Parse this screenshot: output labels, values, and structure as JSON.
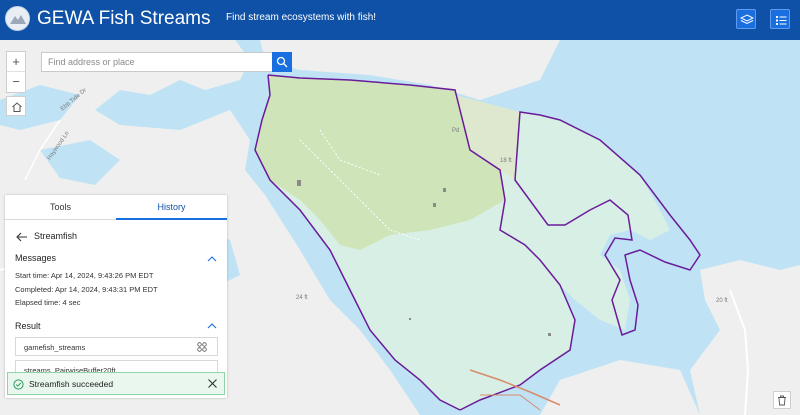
{
  "header": {
    "title": "GEWA Fish Streams",
    "subtitle": "Find stream ecosystems with fish!",
    "layers_icon": "layers-icon",
    "legend_icon": "list-icon",
    "bg_color": "#0e51a7"
  },
  "search": {
    "placeholder": "Find address or place",
    "button_icon": "search-icon"
  },
  "controls": {
    "zoom_in": "+",
    "zoom_out": "−",
    "home_icon": "home-icon",
    "trash_icon": "trash-icon"
  },
  "map": {
    "water_color": "#bfe3f5",
    "land_color": "#efefef",
    "park_color": "#cfe4b8",
    "park_light_color": "#d8efe6",
    "boundary_color": "#6a1b9a",
    "labels": {
      "road1": "Ebb Tide Dr",
      "road2": "Haywood Ln",
      "depth1": "18 ft",
      "depth2": "24 ft",
      "depth3": "20 ft",
      "place": "Pd"
    }
  },
  "panel": {
    "tabs": [
      {
        "label": "Tools",
        "active": false
      },
      {
        "label": "History",
        "active": true
      }
    ],
    "tool_name": "Streamfish",
    "messages": {
      "title": "Messages",
      "start": "Start time: Apr 14, 2024, 9:43:26 PM EDT",
      "completed": "Completed: Apr 14, 2024, 9:43:31 PM EDT",
      "elapsed": "Elapsed time: 4 sec"
    },
    "result": {
      "title": "Result",
      "items": [
        "gamefish_streams",
        "streams_PairwiseBuffer20ft"
      ]
    }
  },
  "toast": {
    "text": "Streamfish succeeded",
    "status_color": "#2e9d5a"
  }
}
